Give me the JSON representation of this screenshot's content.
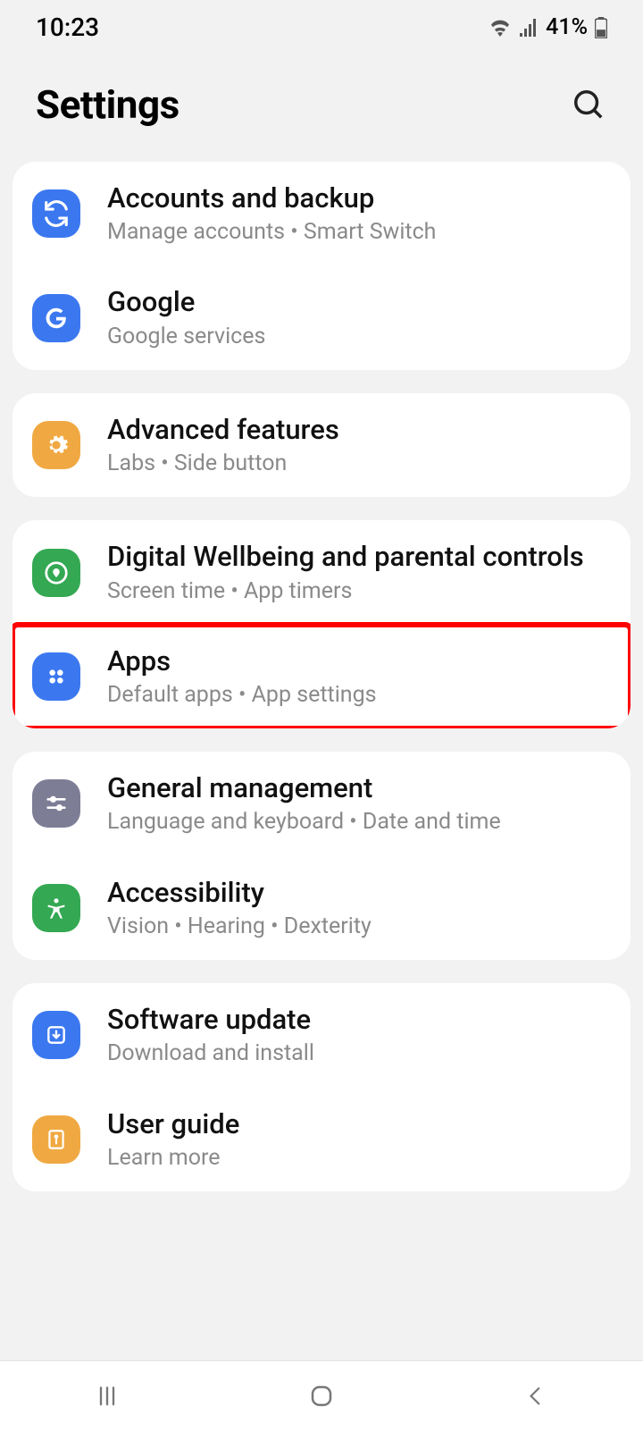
{
  "statusbar": {
    "time": "10:23",
    "battery": "41%"
  },
  "header": {
    "title": "Settings"
  },
  "items": [
    {
      "title": "Accounts and backup",
      "subtitle": "Manage accounts  •  Smart Switch",
      "iconColor": "#3b78f0",
      "icon": "sync"
    },
    {
      "title": "Google",
      "subtitle": "Google services",
      "iconColor": "#3b78f0",
      "icon": "google"
    },
    {
      "title": "Advanced features",
      "subtitle": "Labs  •  Side button",
      "iconColor": "#f0a942",
      "icon": "gear"
    },
    {
      "title": "Digital Wellbeing and parental controls",
      "subtitle": "Screen time  •  App timers",
      "iconColor": "#34a853",
      "icon": "wellbeing"
    },
    {
      "title": "Apps",
      "subtitle": "Default apps  •  App settings",
      "iconColor": "#3b78f0",
      "icon": "apps",
      "highlighted": true
    },
    {
      "title": "General management",
      "subtitle": "Language and keyboard  •  Date and time",
      "iconColor": "#7d7d96",
      "icon": "sliders"
    },
    {
      "title": "Accessibility",
      "subtitle": "Vision  •  Hearing  •  Dexterity",
      "iconColor": "#34a853",
      "icon": "accessibility"
    },
    {
      "title": "Software update",
      "subtitle": "Download and install",
      "iconColor": "#3b78f0",
      "icon": "update"
    },
    {
      "title": "User guide",
      "subtitle": "Learn more",
      "iconColor": "#f0a942",
      "icon": "guide"
    }
  ],
  "groups": [
    [
      0,
      1
    ],
    [
      2
    ],
    [
      3,
      4
    ],
    [
      5,
      6
    ],
    [
      7,
      8
    ]
  ]
}
